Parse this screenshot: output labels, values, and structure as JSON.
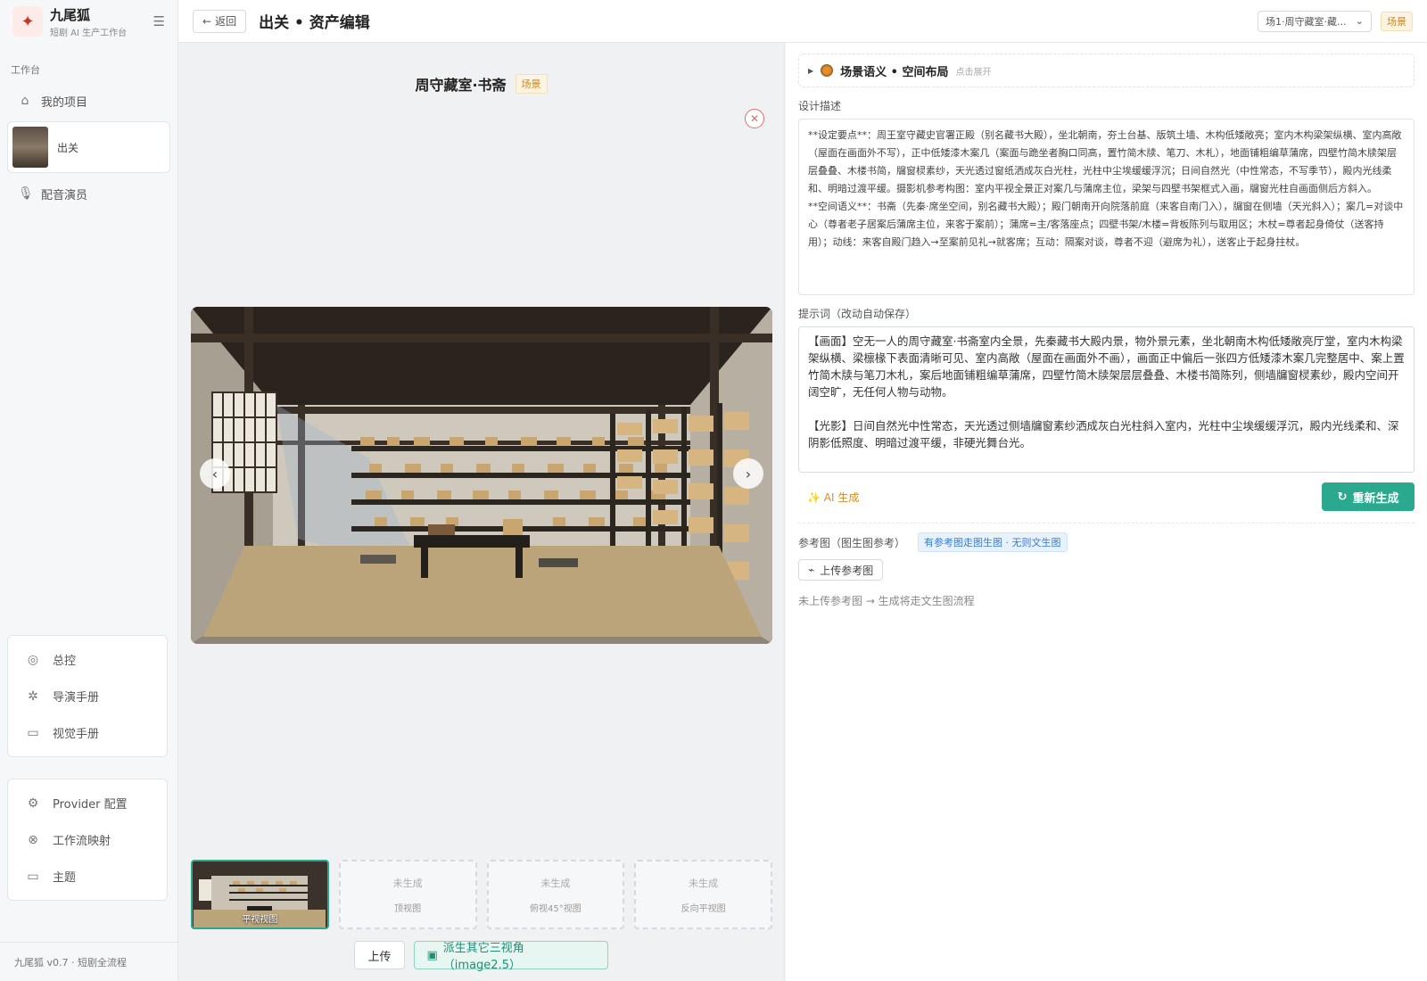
{
  "brand": {
    "name": "九尾狐",
    "subtitle": "短剧 AI 生产工作台"
  },
  "sidebar": {
    "section_label": "工作台",
    "my_projects": "我的项目",
    "project_name": "出关",
    "voice_actors": "配音演员",
    "tools": [
      "总控",
      "导演手册",
      "视觉手册"
    ],
    "settings": [
      "Provider 配置",
      "工作流映射",
      "主题"
    ],
    "footer": "九尾狐 v0.7 · 短剧全流程"
  },
  "topbar": {
    "back_label": "返回",
    "title": "出关 • 资产编辑",
    "scene_select": "场1·周守藏室·藏...",
    "badge": "场景"
  },
  "asset": {
    "name": "周守藏室·书斋",
    "badge": "场景"
  },
  "views": [
    {
      "label": "平视视图",
      "status": ""
    },
    {
      "label": "顶视图",
      "status": "未生成"
    },
    {
      "label": "俯视45°视图",
      "status": "未生成"
    },
    {
      "label": "反向平视图",
      "status": "未生成"
    }
  ],
  "actions": {
    "upload": "上传",
    "derive": "派生其它三视角（image2.5）"
  },
  "right": {
    "collapse_title": "场景语义 • 空间布局",
    "collapse_hint": "点击展开",
    "design_label": "设计描述",
    "design_text": "**设定要点**：周王室守藏史官署正殿（别名藏书大殿），坐北朝南，夯土台基、版筑土墙、木构低矮敞亮；室内木构梁架纵横、室内高敞（屋面在画面外不写），正中低矮漆木案几（案面与跪坐者胸口同高，置竹简木牍、笔刀、木札），地面铺粗编草蒲席，四壁竹简木牍架层层叠叠、木楼书简，牖窗棂素纱，天光透过窗纸洒成灰白光柱，光柱中尘埃缓缓浮沉；日间自然光（中性常态，不写季节），殿内光线柔和、明暗过渡平缓。摄影机参考构图：室内平视全景正对案几与蒲席主位，梁架与四壁书架框式入画，牖窗光柱自画面侧后方斜入。\n**空间语义**：书斋（先秦·席坐空间，别名藏书大殿）；殿门朝南开向院落前庭（来客自南门入），牖窗在侧墙（天光斜入）；案几=对谈中心（尊者老子居案后蒲席主位，来客于案前）；蒲席=主/客落座点；四壁书架/木楼=背板陈列与取用区；木杖=尊者起身倚仗（送客持用）；动线：来客自殿门趋入→至案前见礼→就客席；互动：隔案对谈，尊者不迎（避席为礼），送客止于起身拄杖。",
    "prompt_label": "提示词（改动自动保存）",
    "prompt_text": "【画面】空无一人的周守藏室·书斋室内全景，先秦藏书大殿内景，物外景元素，坐北朝南木构低矮敞亮厅堂，室内木构梁架纵横、梁檩椽下表面清晰可见、室内高敞（屋面在画面外不画），画面正中偏后一张四方低矮漆木案几完整居中、案上置竹简木牍与笔刀木札，案后地面铺粗编草蒲席，四壁竹简木牍架层层叠叠、木楼书简陈列，侧墙牖窗棂素纱，殿内空间开阔空旷，无任何人物与动物。\n\n【光影】日间自然光中性常态，天光透过侧墙牖窗素纱洒成灰白光柱斜入室内，光柱中尘埃缓缓浮沉，殿内光线柔和、深阴影低照度、明暗过渡平缓，非硬光舞台光。",
    "ai_generate": "AI 生成",
    "regenerate": "重新生成",
    "ref_label": "参考图（图生图参考）",
    "ref_tag": "有参考图走图生图 · 无则文生图",
    "upload_ref": "上传参考图",
    "note": "未上传参考图 → 生成将走文生图流程"
  },
  "colors": {
    "accent": "#2aa98f",
    "badge": "#c98a24",
    "link": "#3a7bd5",
    "ai": "#d98b2a"
  }
}
